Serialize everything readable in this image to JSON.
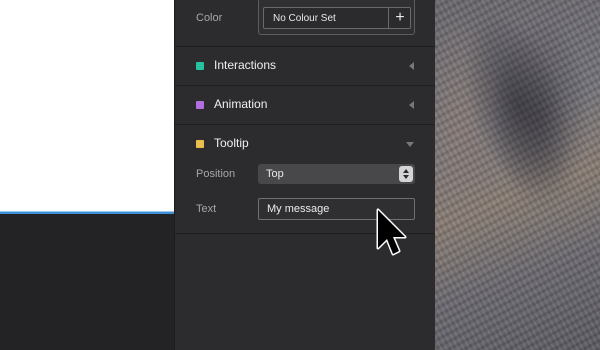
{
  "inspector": {
    "color": {
      "label": "Color",
      "value": "No Colour Set",
      "add_label": "+"
    },
    "sections": [
      {
        "title": "Interactions",
        "swatch": "#27c2a2",
        "state": "collapsed"
      },
      {
        "title": "Animation",
        "swatch": "#b36ee0",
        "state": "collapsed"
      },
      {
        "title": "Tooltip",
        "swatch": "#eabf4f",
        "state": "expanded"
      }
    ],
    "tooltip": {
      "position_label": "Position",
      "position_value": "Top",
      "text_label": "Text",
      "text_value": "My message"
    }
  },
  "colors": {
    "selection": "#3f8fd8",
    "panel_bg": "#2c2c2e"
  },
  "icons": [
    "plus-icon",
    "caret-left-icon",
    "caret-down-icon",
    "stepper-icon",
    "arrow-cursor-icon"
  ]
}
